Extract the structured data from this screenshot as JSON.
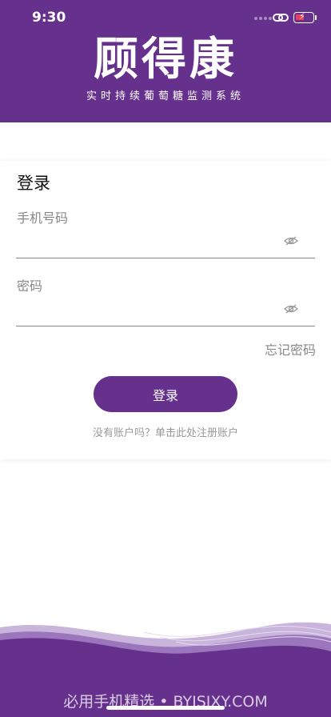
{
  "status_bar": {
    "time": "9:30"
  },
  "header": {
    "logo_text": "顾得康",
    "slogan": "实时持续葡萄糖监测系统"
  },
  "login": {
    "title": "登录",
    "phone_label": "手机号码",
    "phone_value": "",
    "password_label": "密码",
    "password_value": "",
    "forgot_password": "忘记密码",
    "submit_label": "登录",
    "register_prompt": "没有账户吗？单击此处注册账户"
  },
  "footer": {
    "watermark": "必用手机精选 • BYJSJXY.COM"
  },
  "colors": {
    "brand": "#65318c",
    "battery": "#e8405a"
  }
}
